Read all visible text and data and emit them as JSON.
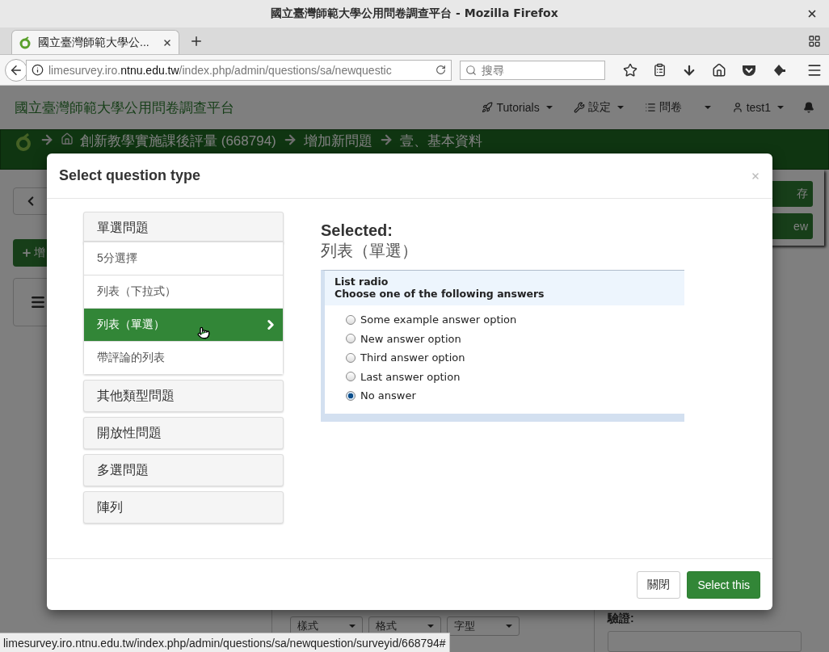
{
  "window": {
    "title": "國立臺灣師範大學公用問卷調查平台 - Mozilla Firefox"
  },
  "browser": {
    "tab_title": "國立臺灣師範大學公...",
    "url": {
      "prefix": "limesurvey.iro.",
      "domain": "ntnu.edu.tw",
      "path": "/index.php/admin/questions/sa/newquestic"
    },
    "search_placeholder": "搜尋"
  },
  "navbar": {
    "brand": "國立臺灣師範大學公用問卷調查平台",
    "menus": [
      {
        "kind": "rocket",
        "label": "Tutorials"
      },
      {
        "kind": "wrench",
        "label": "設定"
      },
      {
        "kind": "list",
        "label": "問卷"
      },
      {
        "kind": "user",
        "label": "test1"
      }
    ]
  },
  "breadcrumb": [
    "創新教學實施課後評量 (668794)",
    "增加新問題",
    "壹、基本資料"
  ],
  "background": {
    "add_button": "增",
    "save_button": "存",
    "preview_button": "ew",
    "toolbar": [
      "樣式",
      "格式",
      "字型"
    ],
    "validation_label": "驗證:"
  },
  "modal": {
    "title": "Select question type",
    "groups": [
      {
        "label": "單選問題",
        "expanded": true,
        "items": [
          {
            "label": "5分選擇",
            "selected": false
          },
          {
            "label": "列表（下拉式）",
            "selected": false
          },
          {
            "label": "列表（單選）",
            "selected": true
          },
          {
            "label": "帶評論的列表",
            "selected": false
          }
        ]
      },
      {
        "label": "其他類型問題",
        "expanded": false
      },
      {
        "label": "開放性問題",
        "expanded": false
      },
      {
        "label": "多選問題",
        "expanded": false
      },
      {
        "label": "陣列",
        "expanded": false
      }
    ],
    "selected_heading": "Selected:",
    "selected_value": "列表（單選）",
    "preview": {
      "title": "List radio",
      "subtitle": "Choose one of the following answers",
      "options": [
        {
          "label": "Some example answer option",
          "checked": false
        },
        {
          "label": "New answer option",
          "checked": false
        },
        {
          "label": "Third answer option",
          "checked": false
        },
        {
          "label": "Last answer option",
          "checked": false
        },
        {
          "label": "No answer",
          "checked": true
        }
      ]
    },
    "buttons": [
      {
        "kind": "default",
        "label": "關閉"
      },
      {
        "kind": "primary",
        "label": "Select this"
      }
    ]
  },
  "status_bar": "limesurvey.iro.ntnu.edu.tw/index.php/admin/questions/sa/newquestion/surveyid/668794#"
}
